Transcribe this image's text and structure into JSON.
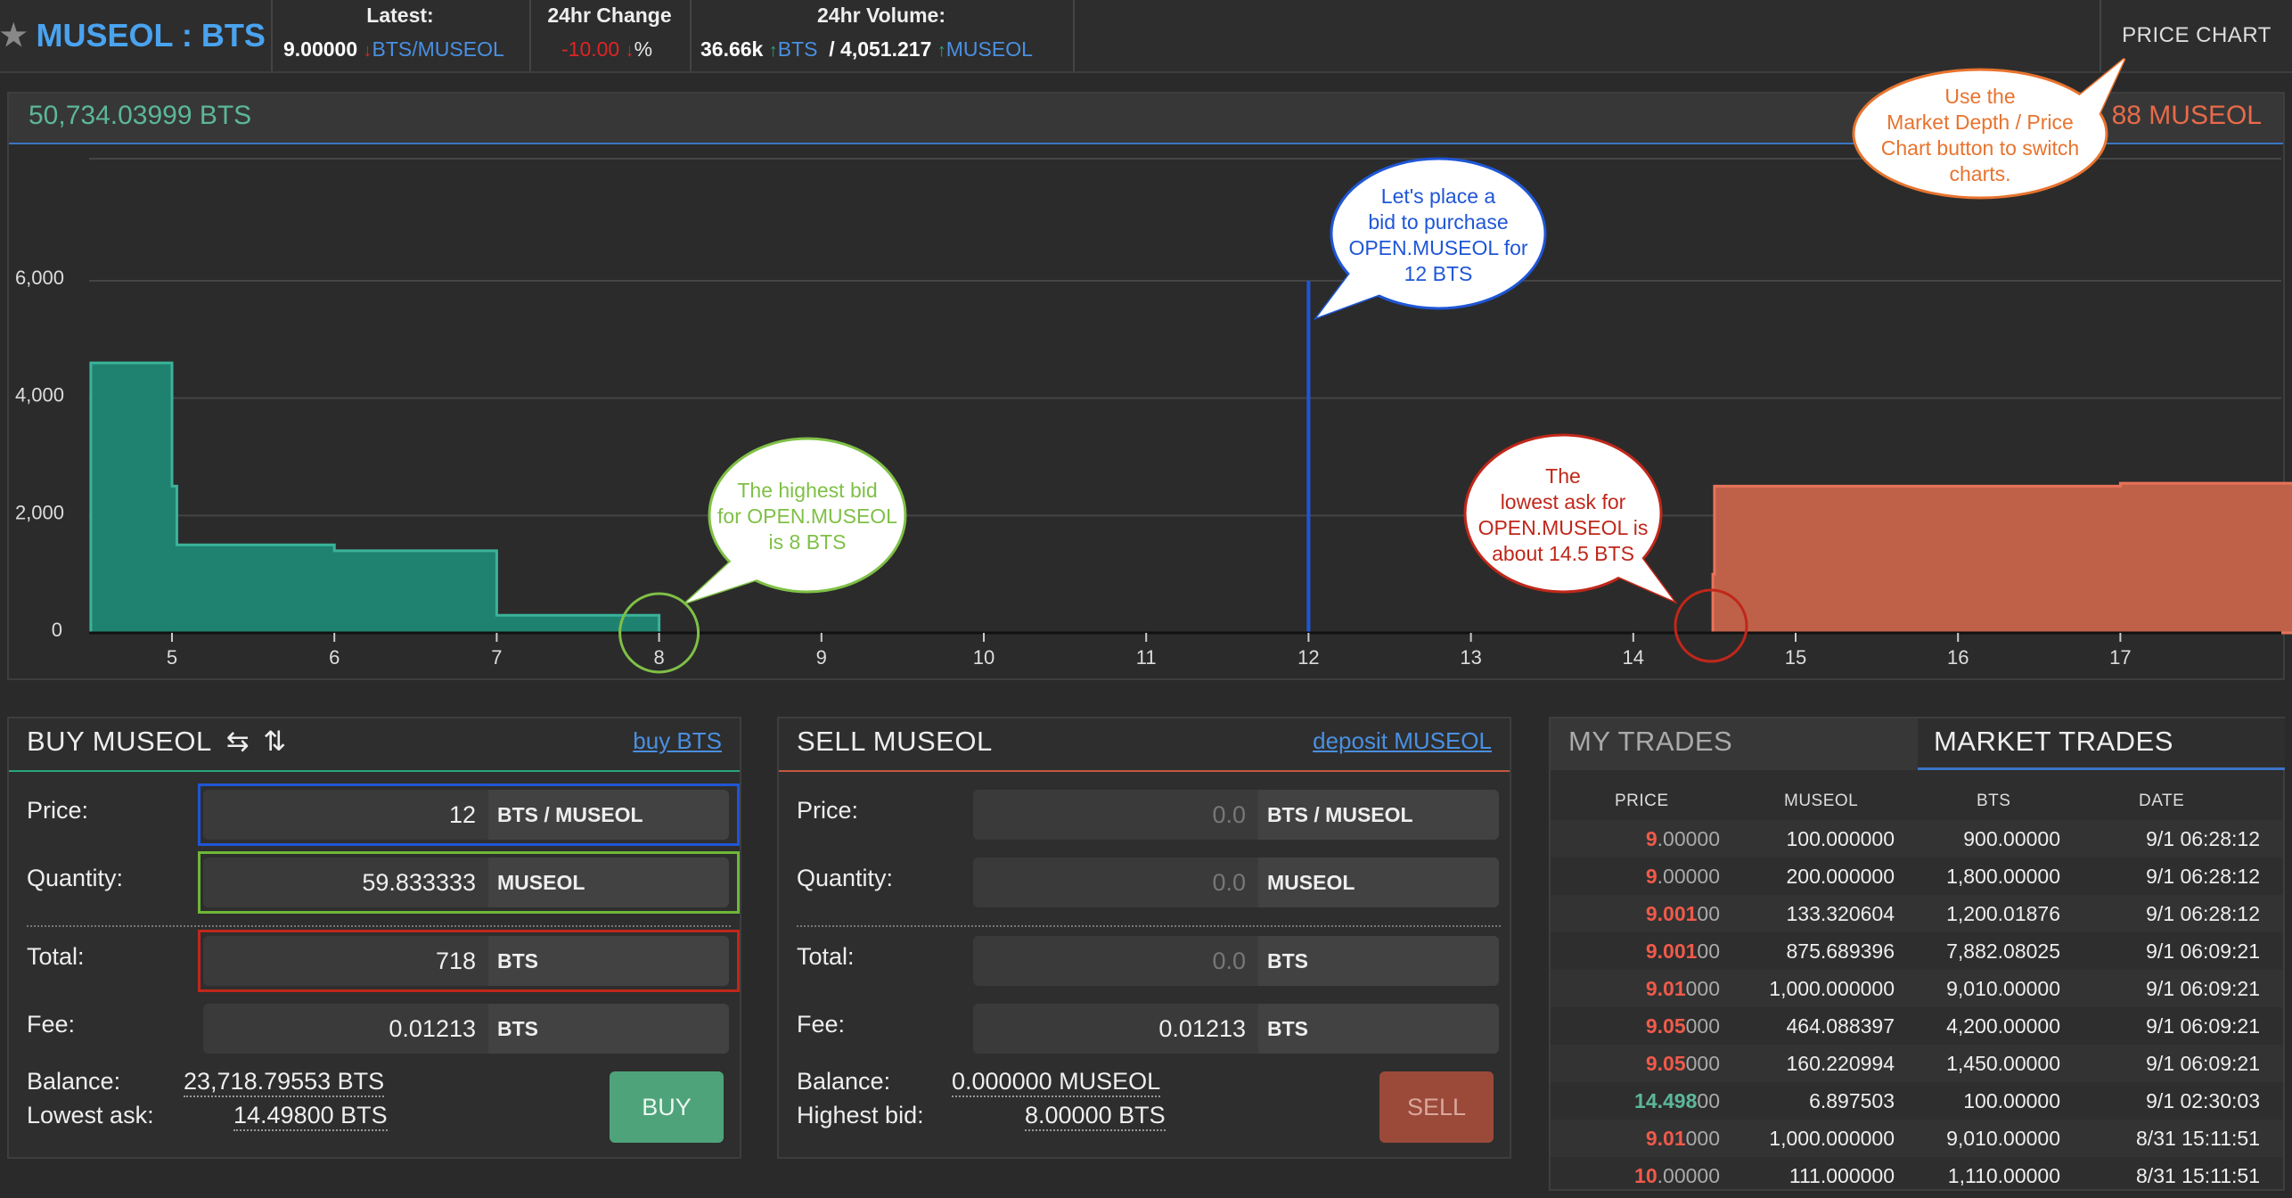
{
  "header": {
    "title": "MUSEOL : BTS",
    "latest_label": "Latest:",
    "latest_value": "9.00000",
    "latest_arrow": "↓",
    "latest_unit": "BTS/MUSEOL",
    "change_label": "24hr Change",
    "change_value": "-10.00",
    "change_arrow": "↓",
    "change_unit": "%",
    "volume_label": "24hr Volume:",
    "volume_bts": "36.66k",
    "volume_bts_arrow": "↑",
    "volume_bts_unit": "BTS",
    "volume_museol": "/ 4,051.217",
    "volume_museol_arrow": "↑",
    "volume_museol_unit": "MUSEOL",
    "price_chart_button": "PRICE CHART"
  },
  "depth_chart": {
    "bts_balance": "50,734.03999 BTS",
    "museol_balance": "88 MUSEOL",
    "y_ticks": [
      "0",
      "2,000",
      "4,000",
      "6,000"
    ],
    "x_ticks": [
      "5",
      "6",
      "7",
      "8",
      "9",
      "10",
      "11",
      "12",
      "13",
      "14",
      "15",
      "16",
      "17"
    ],
    "colors": {
      "bids": "#1f8270",
      "asks": "#bf6149",
      "marker": "#1f56d6"
    },
    "callouts": {
      "order_marker": "Let's place a bid to purchase OPEN.MUSEOL for 12 BTS",
      "highest_bid": "The highest bid for OPEN.MUSEOL is 8 BTS",
      "lowest_ask": "The lowest ask for OPEN.MUSEOL is about 14.5 BTS",
      "switch_charts": "Use the Market Depth / Price Chart button to switch charts."
    }
  },
  "chart_data": {
    "type": "area",
    "xlim": [
      4.5,
      18.5
    ],
    "ylim": [
      0,
      7000
    ],
    "series": [
      {
        "x": [
          4.5,
          5.0,
          5.0,
          5.03,
          5.03,
          6.0,
          6.0,
          7.0,
          7.0,
          8.0
        ],
        "y": [
          4600,
          4600,
          2500,
          2500,
          1500,
          1500,
          1400,
          1400,
          300,
          300
        ]
      },
      {
        "x": [
          14.49,
          14.49,
          14.5,
          14.5,
          17.0,
          17.0,
          18.45,
          18.45
        ],
        "y": [
          0,
          1000,
          1000,
          2500,
          2500,
          2550,
          2550,
          5600
        ]
      }
    ],
    "marker_x": 12,
    "marker_top": 6000
  },
  "buy": {
    "title": "BUY MUSEOL",
    "icon_swap": "⇆",
    "icon_flip": "⇅",
    "link": "buy BTS",
    "price_label": "Price:",
    "price_value": "12",
    "price_unit": "BTS / MUSEOL",
    "quantity_label": "Quantity:",
    "quantity_value": "59.833333",
    "quantity_unit": "MUSEOL",
    "total_label": "Total:",
    "total_value": "718",
    "total_unit": "BTS",
    "fee_label": "Fee:",
    "fee_value": "0.01213",
    "fee_unit": "BTS",
    "balance_label": "Balance:",
    "balance_value": "23,718.79553 BTS",
    "lowest_ask_label": "Lowest ask:",
    "lowest_ask_value": "14.49800 BTS",
    "button": "BUY"
  },
  "sell": {
    "title": "SELL MUSEOL",
    "link": "deposit MUSEOL",
    "price_label": "Price:",
    "price_placeholder": "0.0",
    "price_unit": "BTS / MUSEOL",
    "quantity_label": "Quantity:",
    "quantity_placeholder": "0.0",
    "quantity_unit": "MUSEOL",
    "total_label": "Total:",
    "total_placeholder": "0.0",
    "total_unit": "BTS",
    "fee_label": "Fee:",
    "fee_value": "0.01213",
    "fee_unit": "BTS",
    "balance_label": "Balance:",
    "balance_value": "0.000000 MUSEOL",
    "highest_bid_label": "Highest bid:",
    "highest_bid_value": "8.00000 BTS",
    "button": "SELL"
  },
  "trades": {
    "tab_my": "MY TRADES",
    "tab_market": "MARKET TRADES",
    "columns": [
      "PRICE",
      "MUSEOL",
      "BTS",
      "DATE"
    ],
    "rows": [
      {
        "price_hi": "9",
        "price_lo": ".00000",
        "color": "red",
        "museol": "100.000000",
        "bts": "900.00000",
        "date": "9/1 06:28:12"
      },
      {
        "price_hi": "9",
        "price_lo": ".00000",
        "color": "red",
        "museol": "200.000000",
        "bts": "1,800.00000",
        "date": "9/1 06:28:12"
      },
      {
        "price_hi": "9.001",
        "price_lo": "00",
        "color": "red",
        "museol": "133.320604",
        "bts": "1,200.01876",
        "date": "9/1 06:28:12"
      },
      {
        "price_hi": "9.001",
        "price_lo": "00",
        "color": "red",
        "museol": "875.689396",
        "bts": "7,882.08025",
        "date": "9/1 06:09:21"
      },
      {
        "price_hi": "9.01",
        "price_lo": "000",
        "color": "red",
        "museol": "1,000.000000",
        "bts": "9,010.00000",
        "date": "9/1 06:09:21"
      },
      {
        "price_hi": "9.05",
        "price_lo": "000",
        "color": "red",
        "museol": "464.088397",
        "bts": "4,200.00000",
        "date": "9/1 06:09:21"
      },
      {
        "price_hi": "9.05",
        "price_lo": "000",
        "color": "red",
        "museol": "160.220994",
        "bts": "1,450.00000",
        "date": "9/1 06:09:21"
      },
      {
        "price_hi": "14.498",
        "price_lo": "00",
        "color": "green",
        "museol": "6.897503",
        "bts": "100.00000",
        "date": "9/1 02:30:03"
      },
      {
        "price_hi": "9.01",
        "price_lo": "000",
        "color": "red",
        "museol": "1,000.000000",
        "bts": "9,010.00000",
        "date": "8/31 15:11:51"
      },
      {
        "price_hi": "10",
        "price_lo": ".00000",
        "color": "red",
        "museol": "111.000000",
        "bts": "1,110.00000",
        "date": "8/31 15:11:51"
      }
    ]
  }
}
